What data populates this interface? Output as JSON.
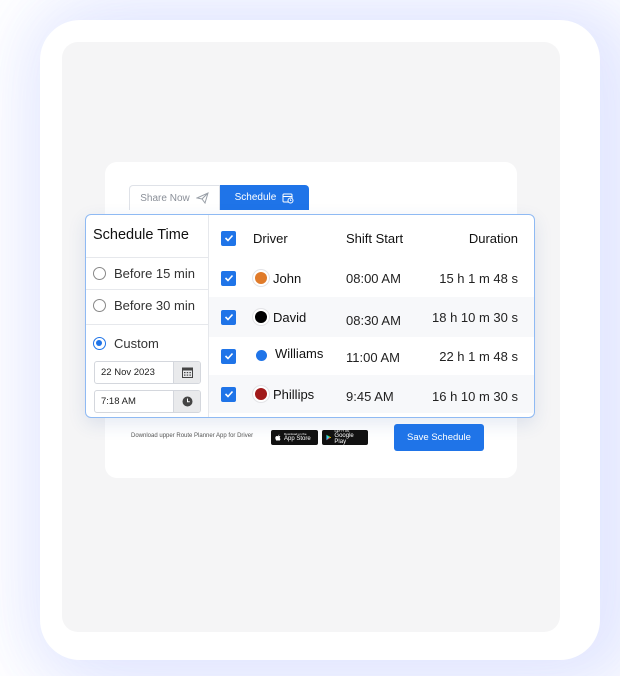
{
  "tabs": {
    "share_now": "Share Now",
    "schedule": "Schedule"
  },
  "schedule_panel": {
    "title": "Schedule Time",
    "options": [
      {
        "label": "Before 15 min",
        "selected": false
      },
      {
        "label": "Before 30 min",
        "selected": false
      },
      {
        "label": "Custom",
        "selected": true
      }
    ],
    "date_value": "22 Nov 2023",
    "time_value": "7:18 AM"
  },
  "table": {
    "headers": {
      "driver": "Driver",
      "shift_start": "Shift Start",
      "duration": "Duration"
    },
    "rows": [
      {
        "driver": "John",
        "shift_start": "08:00 AM",
        "duration": "15 h 1 m 48 s",
        "color": "#e07b2a",
        "checked": true
      },
      {
        "driver": "David",
        "shift_start": "08:30 AM",
        "duration": "18 h 10 m 30 s",
        "color": "#000000",
        "checked": true
      },
      {
        "driver": "Williams",
        "shift_start": "11:00 AM",
        "duration": "22 h 1 m 48 s",
        "color": "#1f74e8",
        "checked": true
      },
      {
        "driver": "Phillips",
        "shift_start": "9:45 AM",
        "duration": "16 h 10 m 30 s",
        "color": "#a11a1a",
        "checked": true
      }
    ]
  },
  "footer": {
    "download_text": "Download upper Route Planner App for Driver",
    "app_store_small": "Download on the",
    "app_store_big": "App Store",
    "google_play_small": "GET IT ON",
    "google_play_big": "Google Play",
    "save_button": "Save Schedule"
  },
  "colors": {
    "accent": "#1f74e8",
    "panel_border": "#8fbaf3"
  },
  "icons": {
    "share": "send-icon",
    "schedule": "calendar-clock-icon",
    "date": "calendar-icon",
    "time": "clock-icon",
    "check": "check-icon",
    "apple": "apple-icon",
    "play": "play-store-icon"
  }
}
